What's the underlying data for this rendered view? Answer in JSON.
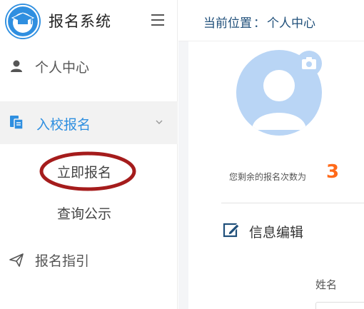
{
  "app": {
    "title": "报名系统"
  },
  "sidebar": {
    "items": [
      {
        "label": "个人中心"
      },
      {
        "label": "入校报名"
      },
      {
        "label": "报名指引"
      }
    ],
    "submenu": [
      {
        "label": "立即报名"
      },
      {
        "label": "查询公示"
      }
    ]
  },
  "breadcrumb": {
    "prefix": "当前位置",
    "separator": "：",
    "current": "个人中心"
  },
  "profile": {
    "remaining_text": "您剩余的报名次数为",
    "remaining_count": "3"
  },
  "form": {
    "section_title": "信息编辑",
    "name_label": "姓名",
    "name_value": ""
  },
  "colors": {
    "accent": "#2f8fe0",
    "count": "#ff6a1a",
    "avatar_bg": "#b9d5f5",
    "ring": "#a51c1c",
    "breadcrumb": "#1f4f7a"
  }
}
